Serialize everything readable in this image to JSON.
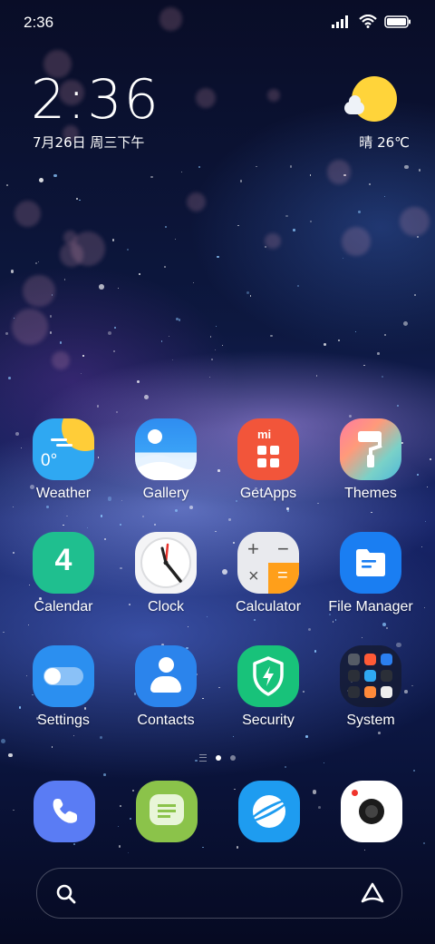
{
  "status_bar": {
    "time": "2:36",
    "icons": [
      "signal-icon",
      "wifi-icon",
      "battery-icon"
    ]
  },
  "clock_widget": {
    "time": "2:36",
    "date": "7月26日 周三下午"
  },
  "weather_widget": {
    "text": "晴 26℃",
    "icon": "sun-cloud-icon"
  },
  "apps": [
    {
      "label": "Weather",
      "icon": "weather-icon",
      "badge": "0°"
    },
    {
      "label": "Gallery",
      "icon": "gallery-icon"
    },
    {
      "label": "GetApps",
      "icon": "getapps-icon",
      "badge": "mi"
    },
    {
      "label": "Themes",
      "icon": "themes-icon"
    },
    {
      "label": "Calendar",
      "icon": "calendar-icon",
      "badge": "4"
    },
    {
      "label": "Clock",
      "icon": "clock-icon"
    },
    {
      "label": "Calculator",
      "icon": "calculator-icon"
    },
    {
      "label": "File Manager",
      "icon": "file-manager-icon"
    },
    {
      "label": "Settings",
      "icon": "settings-icon"
    },
    {
      "label": "Contacts",
      "icon": "contacts-icon"
    },
    {
      "label": "Security",
      "icon": "security-icon"
    },
    {
      "label": "System",
      "icon": "system-folder-icon"
    }
  ],
  "page_indicator": {
    "pages": 2,
    "active": 1
  },
  "dock": [
    {
      "icon": "phone-icon",
      "color": "#5a7cf4"
    },
    {
      "icon": "messages-icon",
      "color": "#8bc34a"
    },
    {
      "icon": "browser-icon",
      "color": "#1e9cf0"
    },
    {
      "icon": "camera-icon",
      "color": "#ffffff"
    }
  ],
  "colors": {
    "weather_bg": "#2fa8f2",
    "getapps_bg": "#f2553a",
    "calendar_bg": "#1fbf8f",
    "files_bg": "#1a7ef2",
    "settings_bg": "#2b8ff0",
    "contacts_bg": "#2b84ec",
    "security_bg": "#18c27a"
  }
}
